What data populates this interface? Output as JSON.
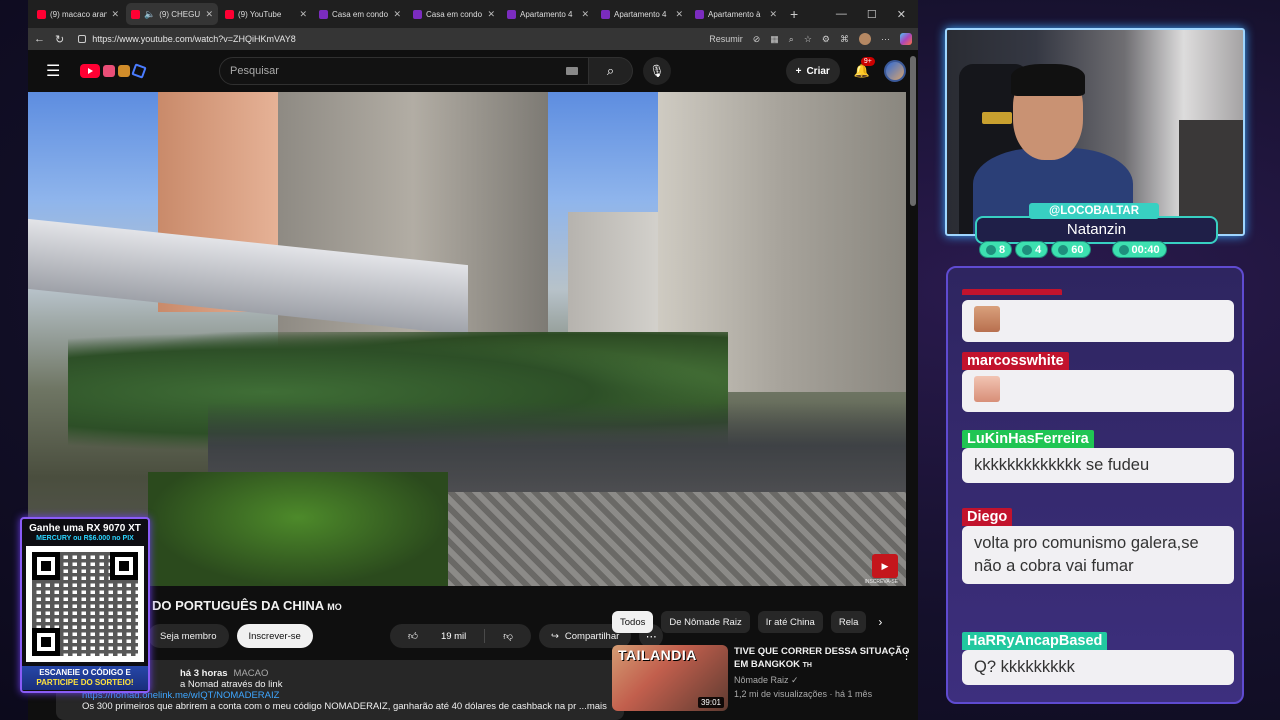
{
  "browser": {
    "tabs": [
      {
        "label": "(9) macaco aran",
        "icon": "youtube-icon",
        "active": false,
        "audio": false
      },
      {
        "label": "(9) CHEGU",
        "icon": "youtube-icon",
        "active": true,
        "audio": true
      },
      {
        "label": "(9) YouTube",
        "icon": "youtube-icon",
        "active": false,
        "audio": false
      },
      {
        "label": "Casa em condo",
        "icon": "listing-icon",
        "active": false,
        "audio": false
      },
      {
        "label": "Casa em condo",
        "icon": "listing-icon",
        "active": false,
        "audio": false
      },
      {
        "label": "Apartamento 4",
        "icon": "listing-icon",
        "active": false,
        "audio": false
      },
      {
        "label": "Apartamento 4",
        "icon": "listing-icon",
        "active": false,
        "audio": false
      },
      {
        "label": "Apartamento à",
        "icon": "listing-icon",
        "active": false,
        "audio": false
      }
    ],
    "url": "https://www.youtube.com/watch?v=ZHQiHKmVAY8",
    "resume_label": "Resumir"
  },
  "youtube": {
    "search_placeholder": "Pesquisar",
    "create_label": "Criar",
    "notifications_badge": "9+",
    "video": {
      "title": "DO PORTUGUÊS DA CHINA",
      "title_suffix": "MO",
      "member_label": "Seja membro",
      "subscribe_label": "Inscrever-se",
      "likes": "19 mil",
      "share_label": "Compartilhar",
      "watermark_label": "INSCREVA-SE"
    },
    "description": {
      "posted": "há 3 horas",
      "location": "MACAO",
      "line1": "a Nomad através do link",
      "link": "https://nomad.onelink.me/wIQT/NOMADERAIZ",
      "line3": "Os 300 primeiros que abrirem a conta com o meu código NOMADERAIZ, ganharão até 40 dólares de cashback na pr",
      "more": "...mais"
    },
    "chips": [
      {
        "label": "Todos",
        "active": true
      },
      {
        "label": "De Nômade Raiz",
        "active": false
      },
      {
        "label": "Ir até China",
        "active": false
      },
      {
        "label": "Rela",
        "active": false
      }
    ],
    "recommendation": {
      "thumb_text": "TAILANDIA",
      "duration": "39:01",
      "title": "TIVE QUE CORRER DESSA SITUAÇÃO EM BANGKOK",
      "title_suffix": "TH",
      "channel": "Nômade Raiz",
      "verified": "✓",
      "stats": "1,2 mi de visualizações · há 1 mês"
    }
  },
  "promo": {
    "title": "Ganhe uma RX 9070 XT",
    "subtitle": "MERCURY ou R$6.000 no PIX",
    "cta1": "ESCANEIE O CÓDIGO E",
    "cta2": "PARTICIPE DO SORTEIO!"
  },
  "streamer": {
    "handle": "@LOCOBALTAR",
    "name": "Natanzin",
    "stats": {
      "chat": "8",
      "video": "4",
      "viewers": "60",
      "time": "00:40"
    }
  },
  "chat": [
    {
      "user": "",
      "text": "",
      "emote": "e1",
      "color": "#c2132d"
    },
    {
      "user": "marcosswhite",
      "text": "",
      "emote": "e2",
      "color": "#c2132d"
    },
    {
      "user": "LuKinHasFerreira",
      "text": "kkkkkkkkkkkkk se fudeu",
      "color": "#20c553"
    },
    {
      "user": "Diego",
      "text": "volta pro comunismo galera,se não a cobra vai fumar",
      "color": "#c2132d"
    },
    {
      "user": "HaRRyAncapBased",
      "text": "Q? kkkkkkkkk",
      "color": "#22c8a0"
    }
  ],
  "colors": {
    "accent": "#8a5cf6",
    "youtube_red": "#ff0033",
    "overlay_teal": "#38d0c2"
  }
}
